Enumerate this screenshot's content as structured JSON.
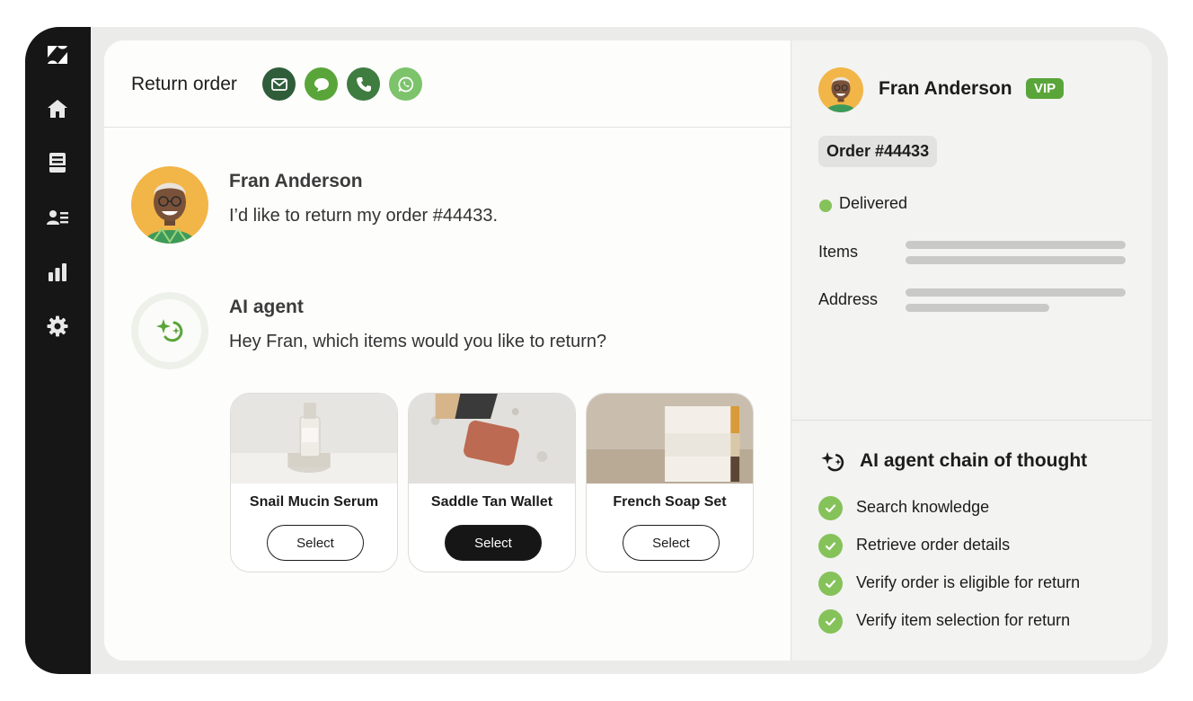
{
  "header": {
    "title": "Return order",
    "channels": [
      "email-icon",
      "chat-icon",
      "phone-icon",
      "whatsapp-icon"
    ]
  },
  "sidebar": {
    "items": [
      "zendesk-logo",
      "home-icon",
      "inbox-icon",
      "contacts-icon",
      "reports-icon",
      "settings-icon"
    ]
  },
  "conversation": [
    {
      "author": "Fran Anderson",
      "text": "I’d like to return my order #44433."
    },
    {
      "author": "AI agent",
      "text": "Hey Fran, which items would you like to return?"
    }
  ],
  "products": [
    {
      "name": "Snail Mucin Serum",
      "button": "Select",
      "selected": false
    },
    {
      "name": "Saddle Tan Wallet",
      "button": "Select",
      "selected": true
    },
    {
      "name": "French Soap Set",
      "button": "Select",
      "selected": false
    }
  ],
  "customer": {
    "name": "Fran Anderson",
    "badge": "VIP",
    "order": "Order #44433",
    "status": "Delivered",
    "fields": [
      "Items",
      "Address"
    ]
  },
  "chain_of_thought": {
    "title": "AI agent chain of thought",
    "steps": [
      "Search knowledge",
      "Retrieve order details",
      "Verify order is eligible for return",
      "Verify item selection for return"
    ]
  },
  "colors": {
    "rail": "#161616",
    "accent_green": "#5aa53a",
    "check_green": "#86c25a",
    "email": "#2f5d3a",
    "chat": "#5aa53a",
    "phone": "#3f7c40",
    "whatsapp": "#7cc36b"
  }
}
